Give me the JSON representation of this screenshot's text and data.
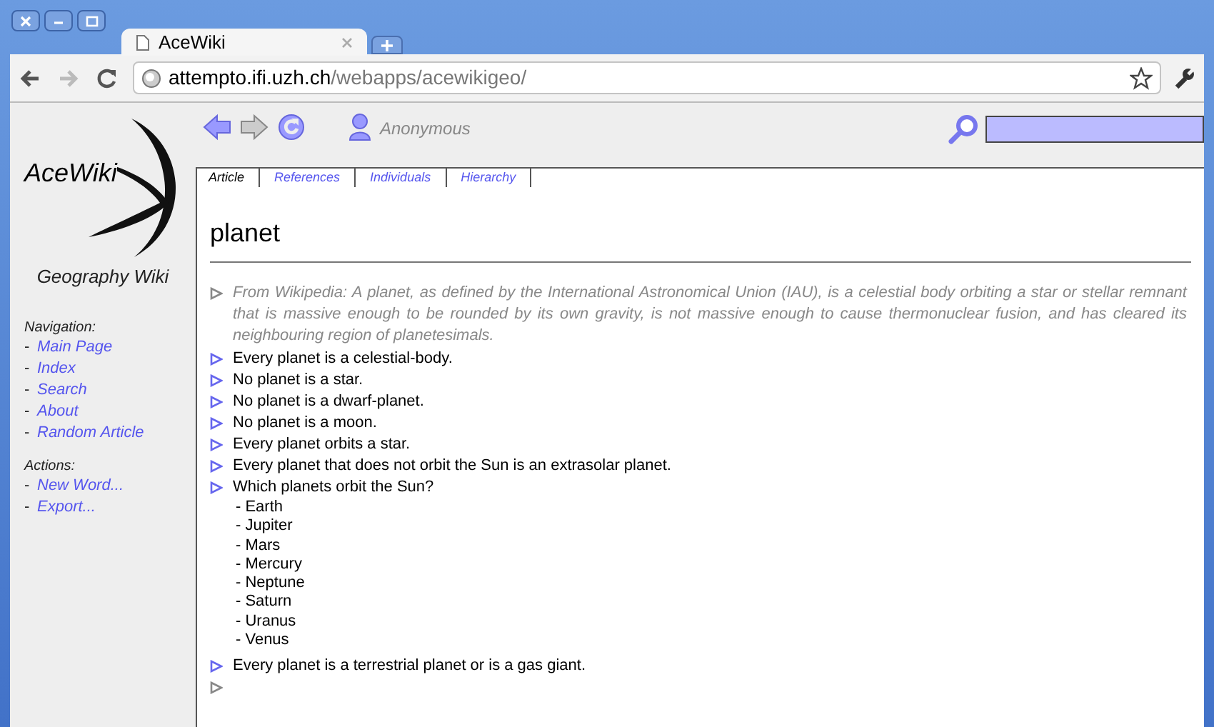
{
  "browser": {
    "tab_title": "AceWiki",
    "url_host": "attempto.ifi.uzh.ch",
    "url_path": "/webapps/acewikigeo/"
  },
  "toolbar": {
    "user": "Anonymous"
  },
  "sidebar": {
    "logo": "AceWiki",
    "subtitle": "Geography Wiki",
    "sections": [
      {
        "title": "Navigation:",
        "items": [
          {
            "bullet": "-",
            "label": "Main Page"
          },
          {
            "bullet": "-",
            "label": "Index"
          },
          {
            "bullet": "-",
            "label": "Search"
          },
          {
            "bullet": "-",
            "label": "About"
          },
          {
            "bullet": "-",
            "label": "Random Article"
          }
        ]
      },
      {
        "title": "Actions:",
        "items": [
          {
            "bullet": "-",
            "label": "New Word..."
          },
          {
            "bullet": "-",
            "label": "Export..."
          }
        ]
      }
    ]
  },
  "tabs": [
    {
      "label": "Article",
      "selected": true
    },
    {
      "label": "References",
      "selected": false
    },
    {
      "label": "Individuals",
      "selected": false
    },
    {
      "label": "Hierarchy",
      "selected": false
    }
  ],
  "title": "planet",
  "statements": [
    {
      "kind": "comment",
      "text": "From Wikipedia: A planet, as defined by the International Astronomical Union (IAU), is a celestial body orbiting a star or stellar remnant that is massive enough to be rounded by its own gravity, is not massive enough to cause thermonuclear fusion, and has cleared its neighbouring region of planetesimals."
    },
    {
      "kind": "sentence",
      "text": "Every planet is a celestial-body."
    },
    {
      "kind": "sentence",
      "text": "No planet is a star."
    },
    {
      "kind": "sentence",
      "text": "No planet is a dwarf-planet."
    },
    {
      "kind": "sentence",
      "text": "No planet is a moon."
    },
    {
      "kind": "sentence",
      "text": "Every planet orbits a star."
    },
    {
      "kind": "sentence",
      "text": "Every planet that does not orbit the Sun is an extrasolar planet."
    },
    {
      "kind": "question",
      "text": "Which planets orbit the Sun?",
      "answers": [
        "- Earth",
        "- Jupiter",
        "- Mars",
        "- Mercury",
        "- Neptune",
        "- Saturn",
        "- Uranus",
        "- Venus"
      ]
    },
    {
      "kind": "sentence",
      "text": "Every planet is a terrestrial planet or is a gas giant."
    },
    {
      "kind": "empty"
    }
  ]
}
